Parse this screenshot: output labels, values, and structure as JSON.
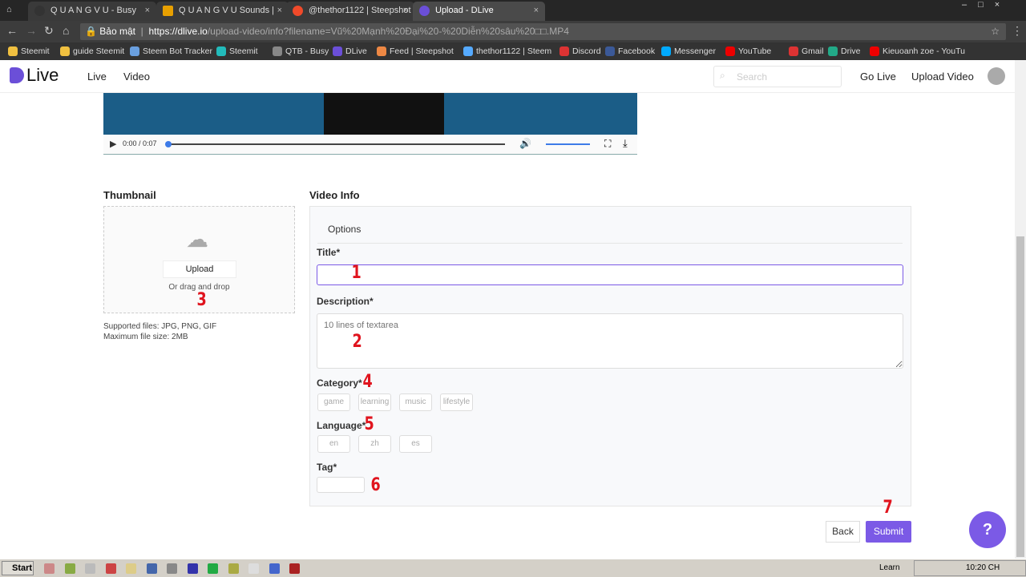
{
  "browser": {
    "tabs": [
      {
        "title": "Q U A N G V U - Busy"
      },
      {
        "title": "Q U A N G V U Sounds | DS"
      },
      {
        "title": "@thethor1122 | Steepshot"
      },
      {
        "title": "Upload - DLive"
      }
    ],
    "security_label": "Bảo mật",
    "url_host": "https://dlive.io",
    "url_path": "/upload-video/info?filename=Vũ%20Mạnh%20Đại%20-%20Diễn%20sâu%20□□.MP4",
    "bookmarks": [
      "Steemit",
      "guide Steemit",
      "Steem Bot Tracker",
      "Steemit",
      "QTB - Busy",
      "DLive",
      "Feed | Steepshot",
      "thethor1122 | Steem",
      "Discord",
      "Facebook",
      "Messenger",
      "YouTube",
      "Gmail",
      "Drive",
      "Kieuoanh zoe - YouTu"
    ],
    "bookmark_colors": [
      "#f0c040",
      "#f0c040",
      "#6aa0e0",
      "#2bb",
      "#888",
      "#6b4fd8",
      "#e84",
      "#5af",
      "#d33",
      "#3b5998",
      "#0af",
      "#e00",
      "#d33",
      "#2a8",
      "#e00"
    ]
  },
  "site": {
    "logo": "Live",
    "nav": [
      "Live",
      "Video"
    ],
    "search_placeholder": "Search",
    "go_live": "Go Live",
    "upload_video": "Upload Video"
  },
  "player": {
    "time": "0:00 / 0:07",
    "progress": 0,
    "volume": 1.0
  },
  "thumbnail": {
    "heading": "Thumbnail",
    "upload_button": "Upload",
    "drag_text": "Or drag and drop",
    "supported": "Supported files: JPG, PNG, GIF",
    "max_size": "Maximum file size: 2MB"
  },
  "info": {
    "heading": "Video Info",
    "tab": "Options",
    "title_label": "Title*",
    "title_value": "",
    "description_label": "Description*",
    "description_placeholder": "10 lines of textarea",
    "category_label": "Category*",
    "categories": [
      "game",
      "learning",
      "music",
      "lifestyle"
    ],
    "language_label": "Language*",
    "languages": [
      "en",
      "zh",
      "es"
    ],
    "tag_label": "Tag*",
    "tag_value": ""
  },
  "actions": {
    "back": "Back",
    "submit": "Submit",
    "help": "?"
  },
  "annotations": [
    "1",
    "2",
    "3",
    "4",
    "5",
    "6",
    "7"
  ],
  "taskbar": {
    "start": "Start",
    "learn": "Learn",
    "clock": "10:20 CH"
  },
  "colors": {
    "accent": "#7b5ae6",
    "annotation": "#e0141e"
  }
}
